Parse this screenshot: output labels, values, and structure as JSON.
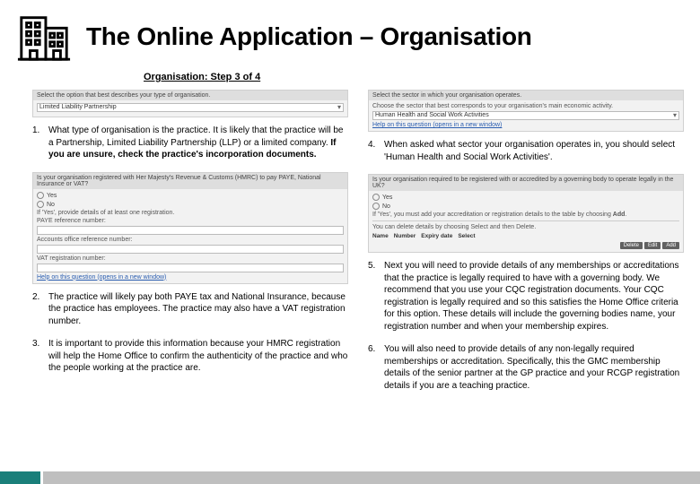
{
  "title": "The Online Application – Organisation",
  "subtitle": "Organisation: Step 3 of 4",
  "shot1": {
    "bar": "Select the option that best describes your type of organisation.",
    "opt": "Limited Liability Partnership"
  },
  "shot2": {
    "bar": "Is your organisation registered with Her Majesty's Revenue & Customs (HMRC) to pay PAYE, National Insurance or VAT?",
    "yes": "Yes",
    "no": "No",
    "hint": "If 'Yes', provide details of at least one registration.",
    "f1": "PAYE reference number:",
    "f2": "Accounts office reference number:",
    "f3": "VAT registration number:",
    "help": "Help on this question (opens in a new window)"
  },
  "shot3": {
    "bar": "Select the sector in which your organisation operates.",
    "hint": "Choose the sector that best corresponds to your organisation's main economic activity.",
    "opt": "Human Health and Social Work Activities",
    "help": "Help on this question (opens in a new window)"
  },
  "shot4": {
    "bar": "Is your organisation required to be registered with or accredited by a governing body to operate legally in the UK?",
    "yes": "Yes",
    "no": "No",
    "hint1": "If 'Yes', you must add your accreditation or registration details to the table by choosing",
    "hint2": "You can delete details by choosing Select and then Delete.",
    "th1": "Name",
    "th2": "Number",
    "th3": "Expiry date",
    "th4": "Select",
    "btn_del": "Delete",
    "btn_edit": "Edit",
    "btn_add": "Add"
  },
  "left": {
    "n1": {
      "num": "1.",
      "text": "What type of organisation is the practice. It is likely that the practice will be a Partnership, Limited Liability Partnership (LLP) or a limited company. ",
      "bold": "If you are unsure, check the practice's incorporation documents."
    },
    "n2": {
      "num": "2.",
      "text": "The practice will likely pay both PAYE tax and National Insurance, because the practice has employees. The practice may also have a VAT registration number."
    },
    "n3": {
      "num": "3.",
      "text": "It is important to provide this information because your HMRC registration will help the Home Office to confirm the authenticity of the practice and who the people working at the practice are."
    }
  },
  "right": {
    "n4": {
      "num": "4.",
      "text": "When asked what sector your organisation operates in, you should select 'Human Health and Social Work Activities'."
    },
    "n5": {
      "num": "5.",
      "text": "Next you will need to provide details of any memberships or accreditations that the practice is legally required to have with a governing body. We recommend that you use your CQC registration documents. Your CQC registration is legally required and so this satisfies the Home Office criteria for this option. These details will include the governing bodies name, your registration number and when your membership expires."
    },
    "n6": {
      "num": "6.",
      "text": "You will also need to provide details of any non-legally required memberships or accreditation. Specifically, this the GMC membership details of the senior partner at the GP practice and your RCGP registration details if you are a teaching practice."
    }
  }
}
